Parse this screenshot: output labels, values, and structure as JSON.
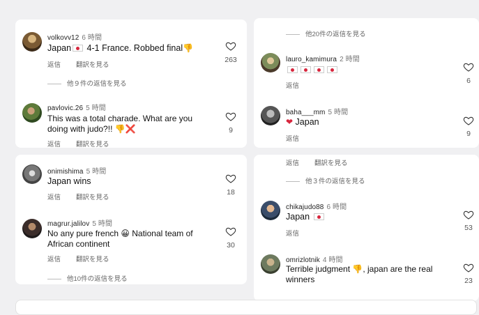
{
  "left_top": {
    "c1": {
      "user": "volkovv12",
      "time": "6 時間",
      "text_a": "Japan",
      "text_b": " 4-1 France. Robbed final",
      "reply": "返信",
      "translate": "翻訳を見る",
      "likes": "263",
      "more": "他９件の返信を見る"
    },
    "c2": {
      "user": "pavlovic.26",
      "time": "5 時間",
      "line1": "This was a total charade. What are you",
      "line2": "doing with judo?!! ",
      "reply": "返信",
      "translate": "翻訳を見る",
      "likes": "9"
    }
  },
  "left_bottom": {
    "c3": {
      "user": "onimishima",
      "time": "5 時間",
      "text": "Japan wins",
      "reply": "返信",
      "translate": "翻訳を見る",
      "likes": "18"
    },
    "c4": {
      "user": "magrur.jalilov",
      "time": "5 時間",
      "line1_a": "No any pure french ",
      "line1_b": " National team of",
      "line2": "African continent",
      "reply": "返信",
      "translate": "翻訳を見る",
      "likes": "30",
      "more": "他10件の返信を見る"
    }
  },
  "right_top": {
    "more_top": "他20件の返信を見る",
    "c5": {
      "user": "lauro_kamimura",
      "time": "2 時間",
      "reply": "返信",
      "likes": "6"
    },
    "c6": {
      "user": "baha___mm",
      "time": "5 時間",
      "text": "Japan",
      "reply": "返信",
      "likes": "9"
    }
  },
  "right_bottom": {
    "reply": "返信",
    "translate": "翻訳を見る",
    "more": "他３件の返信を見る",
    "c7": {
      "user": "chikajudo88",
      "time": "6 時間",
      "text": "Japan ",
      "reply": "返信",
      "likes": "53"
    },
    "c8": {
      "user": "omrizlotnik",
      "time": "4 時間",
      "line1_a": "Terrible judgment ",
      "line1_b": ", japan are the real",
      "line2": "winners",
      "likes": "23"
    }
  },
  "icons": {
    "like": "heart-outline-icon",
    "thumbs_down": "thumbs-down-emoji",
    "cross": "cross-mark-emoji",
    "heart": "red-heart-emoji",
    "flag": "japan-flag-emoji",
    "grin": "grinning-face-emoji"
  },
  "colors": {
    "heart_red": "#d7263d",
    "thumb_yellow": "#f4b400"
  }
}
